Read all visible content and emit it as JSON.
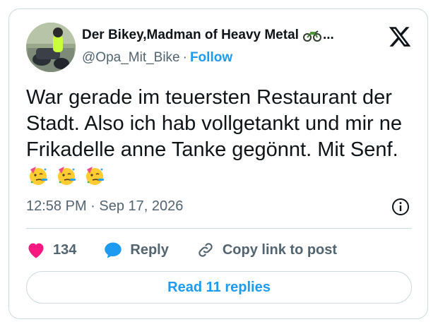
{
  "tweet": {
    "author_name": "Der Bikey,Madman of Heavy Metal",
    "name_ellipsis": "...",
    "handle": "@Opa_Mit_Bike",
    "separator": "·",
    "follow_label": "Follow",
    "text": "War gerade im teuersten Restaurant der Stadt. Also ich hab vollgetankt und mir ne Frikadelle anne Tanke gegönnt. Mit Senf.",
    "emoji_count": 3,
    "timestamp": "12:58 PM · Sep 17, 2026"
  },
  "actions": {
    "likes_count": "134",
    "reply_label": "Reply",
    "copy_link_label": "Copy link to post"
  },
  "read_replies_label": "Read 11 replies",
  "icons": {
    "brand": "x-logo-icon",
    "author_badge": "motorcycle-icon",
    "emoji": "partying-face-icon",
    "info": "info-icon",
    "like": "heart-icon",
    "reply": "speech-bubble-icon",
    "copy": "link-icon"
  },
  "colors": {
    "accent": "#1d9bf0",
    "heart": "#f91880",
    "text": "#0f1419",
    "muted": "#536471",
    "border": "#cfd9de"
  }
}
